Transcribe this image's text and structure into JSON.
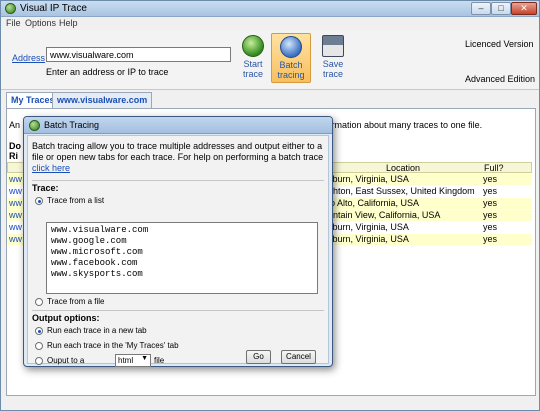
{
  "window": {
    "title": "Visual IP Trace"
  },
  "menu": [
    "File",
    "Options",
    "Help"
  ],
  "toolbar": {
    "address_label": "Address",
    "address_value": "www.visualware.com",
    "hint": "Enter an address or IP to trace",
    "buttons": [
      {
        "label1": "Start",
        "label2": "trace",
        "icon": "globe-play-icon"
      },
      {
        "label1": "Batch",
        "label2": "tracing",
        "icon": "batch-globe-icon"
      },
      {
        "label1": "Save",
        "label2": "trace",
        "icon": "floppy-disk-icon"
      }
    ],
    "licence": "Licenced Version",
    "edition": "Advanced Edition"
  },
  "tabs": [
    "My Traces",
    "www.visualware.com"
  ],
  "background": {
    "an": "An",
    "info": "formation about many traces to one file.",
    "do": "Do",
    "ri": "Ri",
    "table_header": {
      "location": "Location",
      "full": "Full?"
    },
    "rows": [
      {
        "c0": "ww",
        "location": "shburn, Virginia, USA",
        "full": "yes"
      },
      {
        "c0": "ww",
        "location": "righton, East Sussex, United Kingdom",
        "full": "yes"
      },
      {
        "c0": "ww",
        "location": "alo Alto, California, USA",
        "full": "yes"
      },
      {
        "c0": "ww",
        "location": "ountain View, California, USA",
        "full": "yes"
      },
      {
        "c0": "ww",
        "location": "shburn, Virginia, USA",
        "full": "yes"
      },
      {
        "c0": "ww",
        "location": "shburn, Virginia, USA",
        "full": "yes"
      }
    ]
  },
  "dialog": {
    "title": "Batch Tracing",
    "description": "Batch tracing allow you to trace multiple addresses and output either to a file or open new tabs for each trace. For help on performing a batch trace",
    "help_link": "click here",
    "trace_section": "Trace:",
    "trace_from_list": "Trace from a list",
    "addresses": [
      "www.visualware.com",
      "www.google.com",
      "www.microsoft.com",
      "www.facebook.com",
      "www.skysports.com"
    ],
    "trace_from_file": "Trace from a file",
    "output_section": "Output options:",
    "out_new_tab": "Run each trace in a new tab",
    "out_my_traces": "Run each trace in the 'My Traces' tab",
    "out_file_prefix": "Ouput to a",
    "out_format": "html",
    "out_file_suffix": "file",
    "go": "Go",
    "cancel": "Cancel"
  }
}
